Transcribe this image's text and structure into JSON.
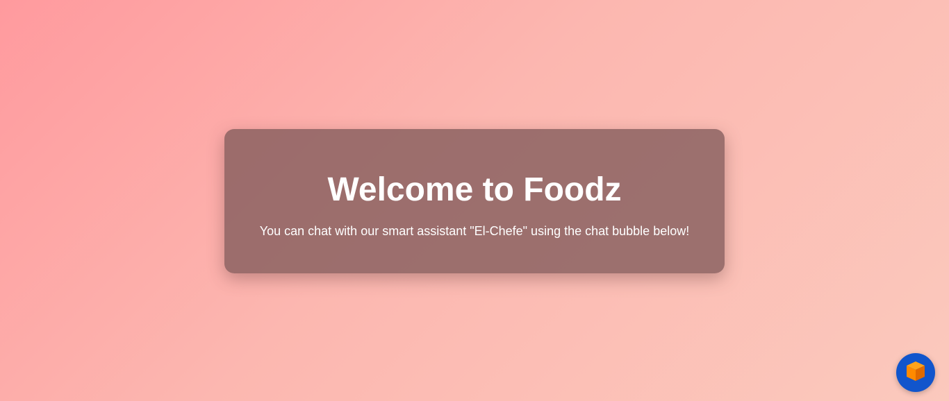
{
  "card": {
    "title": "Welcome to Foodz",
    "subtitle": "You can chat with our smart assistant \"El-Chefe\" using the chat bubble below!"
  },
  "chat_bubble": {
    "icon": "cube-icon",
    "background_color": "#1155cc",
    "icon_color": "#ff8a00"
  },
  "colors": {
    "background_start": "#ff9a9e",
    "background_end": "#fbc9bd",
    "card_background": "#805a5a",
    "text": "#ffffff"
  }
}
